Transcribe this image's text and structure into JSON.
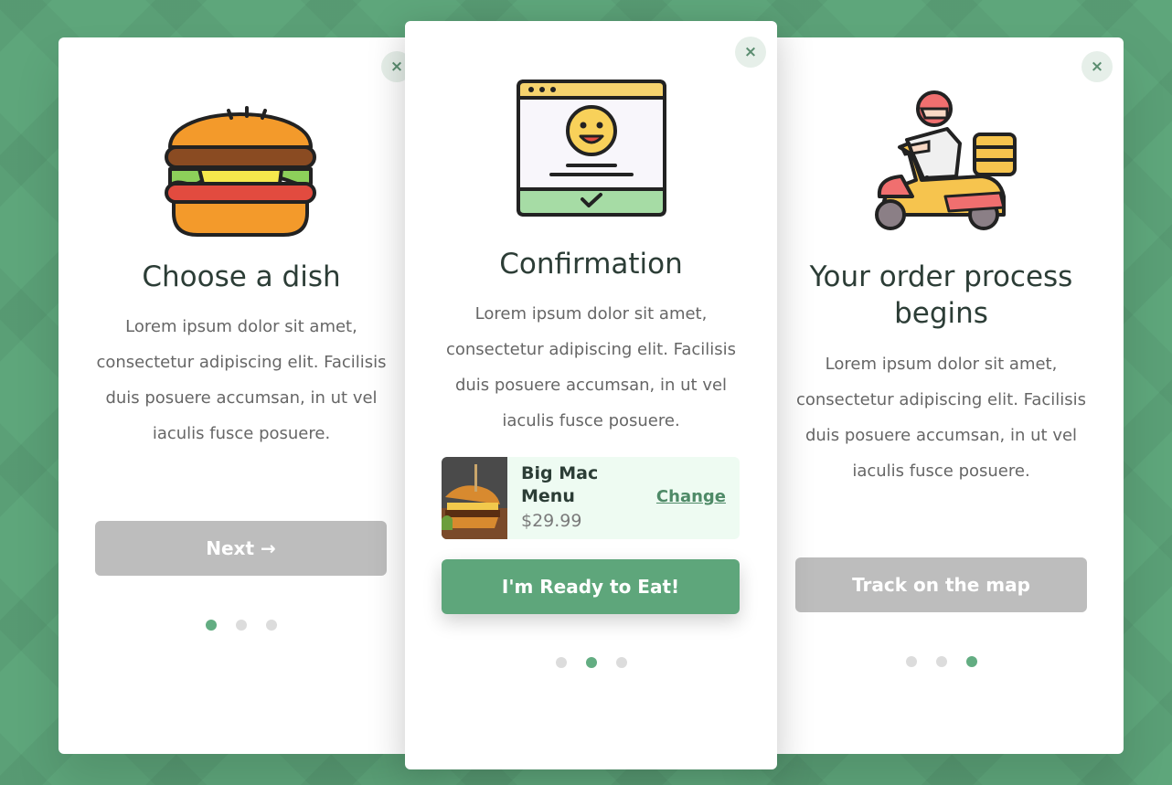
{
  "cards": [
    {
      "title": "Choose a dish",
      "illustration": "burger-icon",
      "description": "Lorem ipsum dolor sit amet, consectetur adipiscing elit. Facilisis duis posuere accumsan, in ut vel iaculis fusce posuere.",
      "button_label": "Next →",
      "close_icon": "×",
      "active_dot": 0
    },
    {
      "title": "Confirmation",
      "illustration": "browser-smiley-icon",
      "description": "Lorem ipsum dolor sit amet, consectetur adipiscing elit. Facilisis duis posuere accumsan, in ut vel iaculis fusce posuere.",
      "order": {
        "item_name": "Big Mac Menu",
        "price": "$29.99",
        "change_label": "Change"
      },
      "button_label": "I'm Ready to Eat!",
      "close_icon": "×",
      "active_dot": 1
    },
    {
      "title": "Your order process begins",
      "illustration": "delivery-scooter-icon",
      "description": "Lorem ipsum dolor sit amet, consectetur adipiscing elit. Facilisis duis posuere accumsan, in ut vel iaculis fusce posuere.",
      "button_label": "Track on the map",
      "close_icon": "×",
      "active_dot": 2
    }
  ],
  "colors": {
    "background": "#5ea67b",
    "accent": "#5ea67b",
    "disabled_button": "#bdbdbd",
    "title": "#2c3d36",
    "body_text": "#666666"
  }
}
